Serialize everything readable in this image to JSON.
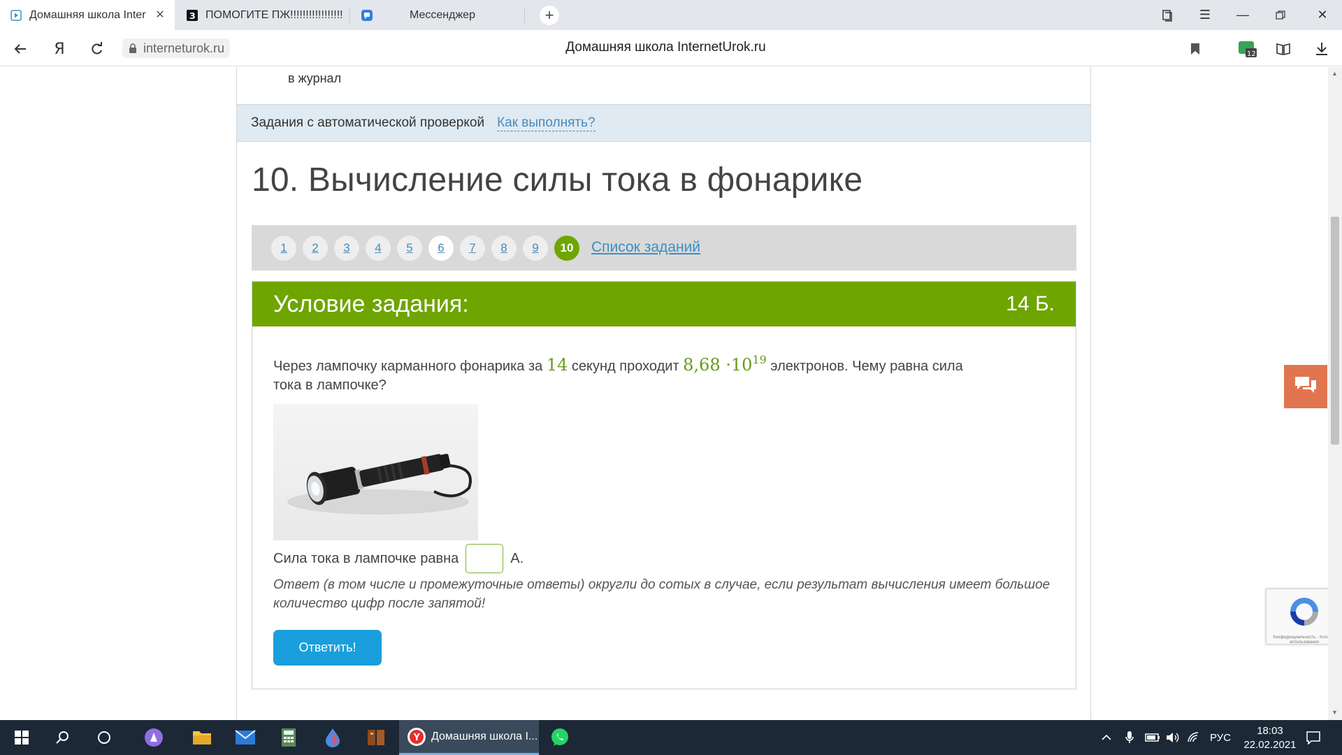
{
  "browser": {
    "tabs": [
      {
        "title": "Домашняя школа Inter",
        "active": true,
        "icon": "play-icon"
      },
      {
        "title": "ПОМОГИТЕ ПЖ!!!!!!!!!!!!!!!!!",
        "active": false,
        "icon": "znanija-icon"
      },
      {
        "title": "Мессенджер",
        "active": false,
        "icon": "messenger-icon"
      }
    ],
    "url": "interneturok.ru",
    "page_title": "Домашняя школа InternetUrok.ru",
    "downloads_badge": "12"
  },
  "page": {
    "journal_text": "в журнал",
    "auto_check_label": "Задания с автоматической проверкой",
    "how_to_link": "Как выполнять?",
    "heading": "10. Вычисление силы тока в фонарике",
    "pager": {
      "numbers": [
        "1",
        "2",
        "3",
        "4",
        "5",
        "6",
        "7",
        "8",
        "9",
        "10"
      ],
      "current": "10",
      "list_link": "Список заданий"
    },
    "task": {
      "header": "Условие задания:",
      "points": "14 Б.",
      "q_part1": "Через лампочку карманного фонарика за ",
      "q_seconds": "14",
      "q_part2": " секунд проходит ",
      "q_mantissa": "8,68 ·10",
      "q_exponent": "19",
      "q_part3": " электронов. Чему равна сила тока в лампочке?",
      "answer_label": "Сила тока в лампочке равна",
      "answer_unit": "А.",
      "answer_value": "",
      "hint": "Ответ (в том числе и промежуточные ответы) округли до сотых в случае, если результат вычисления имеет большое количество цифр после запятой!",
      "submit_label": "Ответить!"
    },
    "recaptcha_caption": "Конфиденциальность - Условия использования"
  },
  "taskbar": {
    "active_window": "Домашняя школа I...",
    "lang": "РУС",
    "time": "18:03",
    "date": "22.02.2021"
  },
  "colors": {
    "accent_green": "#6ea500",
    "link_blue": "#3b8fc4",
    "submit_blue": "#1a9fdd",
    "chat_orange": "#e07550"
  }
}
